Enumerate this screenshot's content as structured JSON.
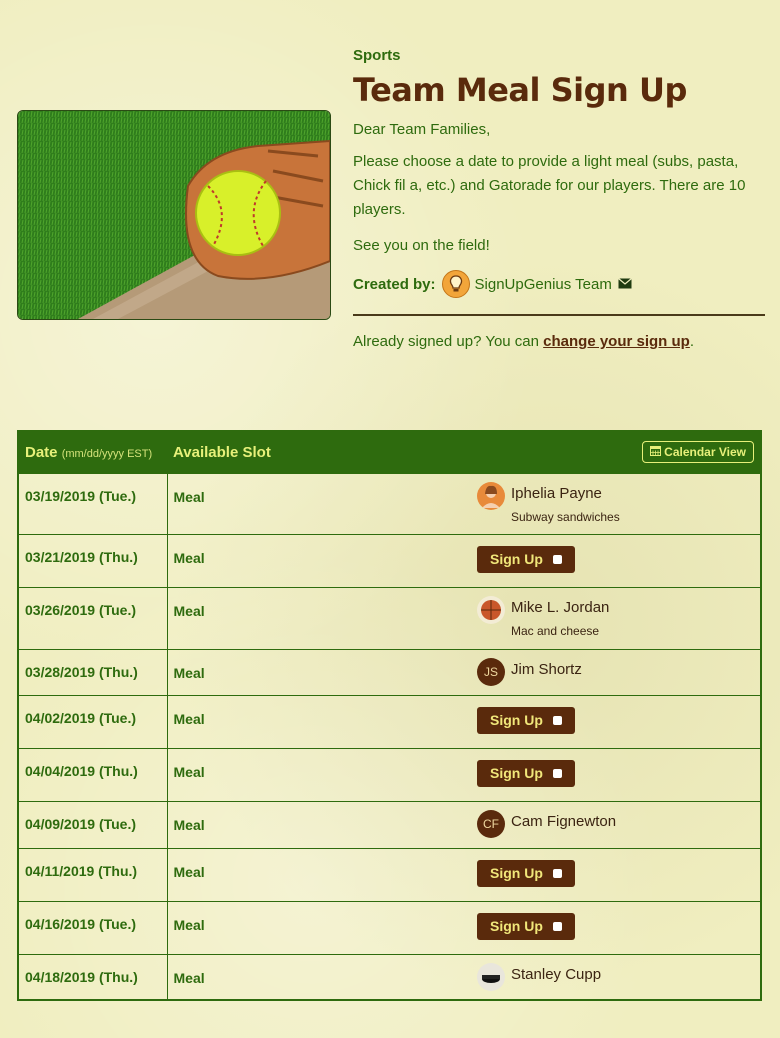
{
  "header": {
    "category": "Sports",
    "title": "Team Meal Sign Up",
    "greeting": "Dear Team Families,",
    "description": "Please choose a date to provide a light meal (subs, pasta, Chick fil a, etc.) and Gatorade for our players. There are 10 players.",
    "closing": "See you on the field!",
    "created_by_label": "Created by:",
    "creator_name": "SignUpGenius Team",
    "already_text": "Already signed up? You can ",
    "change_link": "change your sign up",
    "already_end": "."
  },
  "table": {
    "date_header": "Date",
    "date_sub": "(mm/dd/yyyy EST)",
    "slot_header": "Available Slot",
    "calendar_view": "Calendar View",
    "signup_label": "Sign Up",
    "rows": [
      {
        "date": "03/19/2019 (Tue.)",
        "slot": "Meal",
        "name": "Iphelia Payne",
        "note": "Subway sandwiches",
        "avatar": "photo-orange"
      },
      {
        "date": "03/21/2019 (Thu.)",
        "slot": "Meal"
      },
      {
        "date": "03/26/2019 (Tue.)",
        "slot": "Meal",
        "name": "Mike L. Jordan",
        "note": "Mac and cheese",
        "avatar": "photo-basketball"
      },
      {
        "date": "03/28/2019 (Thu.)",
        "slot": "Meal",
        "name": "Jim Shortz",
        "initials": "JS"
      },
      {
        "date": "04/02/2019 (Tue.)",
        "slot": "Meal"
      },
      {
        "date": "04/04/2019 (Thu.)",
        "slot": "Meal"
      },
      {
        "date": "04/09/2019 (Tue.)",
        "slot": "Meal",
        "name": "Cam Fignewton",
        "initials": "CF"
      },
      {
        "date": "04/11/2019 (Thu.)",
        "slot": "Meal"
      },
      {
        "date": "04/16/2019 (Tue.)",
        "slot": "Meal"
      },
      {
        "date": "04/18/2019 (Thu.)",
        "slot": "Meal",
        "name": "Stanley Cupp",
        "avatar": "photo-hockey"
      }
    ]
  },
  "colors": {
    "green": "#2e6b0e",
    "brown": "#5a2a0c",
    "header_text": "#e7f07a",
    "background": "#f0eec0"
  }
}
